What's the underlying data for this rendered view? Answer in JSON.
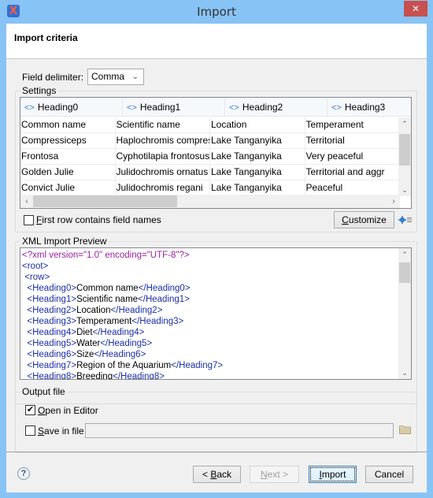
{
  "window": {
    "title": "Import",
    "app_icon": "oxygen-x-icon",
    "close_label": "✕"
  },
  "header": {
    "title": "Import criteria"
  },
  "delimiter": {
    "label": "Field delimiter:",
    "value": "Comma"
  },
  "settings": {
    "legend": "Settings",
    "columns": [
      "Heading0",
      "Heading1",
      "Heading2",
      "Heading3"
    ],
    "rows": [
      [
        "Common name",
        "Scientific name",
        "Location",
        "Temperament"
      ],
      [
        "Compressiceps",
        "Haplochromis compressi...",
        "Lake Tanganyika",
        "Territorial"
      ],
      [
        "Frontosa",
        "Cyphotilapia frontosus",
        "Lake Tanganyika",
        "Very peaceful"
      ],
      [
        "Golden Julie",
        "Julidochromis ornatus",
        "Lake Tanganyika",
        "Territorial and aggr"
      ],
      [
        "Convict Julie",
        "Julidochromis regani",
        "Lake Tanganyika",
        "Peaceful"
      ]
    ],
    "vertical_scroll_position": 0.3,
    "horizontal_scroll_position": 0.0,
    "first_row_label_prefix": "F",
    "first_row_label_rest": "irst row contains field names",
    "first_row_checked": false,
    "customize_prefix": "C",
    "customize_rest": "ustomize"
  },
  "xml_preview": {
    "legend": "XML Import Preview",
    "lines": [
      {
        "indent": "",
        "parts": [
          {
            "cls": "pi",
            "t": "<?xml version=\"1.0\" encoding=\"UTF-8\"?>"
          }
        ]
      },
      {
        "indent": "",
        "parts": [
          {
            "cls": "tg",
            "t": "<root>"
          }
        ]
      },
      {
        "indent": " ",
        "parts": [
          {
            "cls": "tg",
            "t": "<row>"
          }
        ]
      },
      {
        "indent": "  ",
        "parts": [
          {
            "cls": "tg",
            "t": "<Heading0>"
          },
          {
            "cls": "txt",
            "t": "Common name"
          },
          {
            "cls": "tg",
            "t": "</Heading0>"
          }
        ]
      },
      {
        "indent": "  ",
        "parts": [
          {
            "cls": "tg",
            "t": "<Heading1>"
          },
          {
            "cls": "txt",
            "t": "Scientific name"
          },
          {
            "cls": "tg",
            "t": "</Heading1>"
          }
        ]
      },
      {
        "indent": "  ",
        "parts": [
          {
            "cls": "tg",
            "t": "<Heading2>"
          },
          {
            "cls": "txt",
            "t": "Location"
          },
          {
            "cls": "tg",
            "t": "</Heading2>"
          }
        ]
      },
      {
        "indent": "  ",
        "parts": [
          {
            "cls": "tg",
            "t": "<Heading3>"
          },
          {
            "cls": "txt",
            "t": "Temperament"
          },
          {
            "cls": "tg",
            "t": "</Heading3>"
          }
        ]
      },
      {
        "indent": "  ",
        "parts": [
          {
            "cls": "tg",
            "t": "<Heading4>"
          },
          {
            "cls": "txt",
            "t": "Diet"
          },
          {
            "cls": "tg",
            "t": "</Heading4>"
          }
        ]
      },
      {
        "indent": "  ",
        "parts": [
          {
            "cls": "tg",
            "t": "<Heading5>"
          },
          {
            "cls": "txt",
            "t": "Water"
          },
          {
            "cls": "tg",
            "t": "</Heading5>"
          }
        ]
      },
      {
        "indent": "  ",
        "parts": [
          {
            "cls": "tg",
            "t": "<Heading6>"
          },
          {
            "cls": "txt",
            "t": "Size"
          },
          {
            "cls": "tg",
            "t": "</Heading6>"
          }
        ]
      },
      {
        "indent": "  ",
        "parts": [
          {
            "cls": "tg",
            "t": "<Heading7>"
          },
          {
            "cls": "txt",
            "t": "Region of the Aquarium"
          },
          {
            "cls": "tg",
            "t": "</Heading7>"
          }
        ]
      },
      {
        "indent": "  ",
        "parts": [
          {
            "cls": "tg",
            "t": "<Heading8>"
          },
          {
            "cls": "txt",
            "t": "Breeding"
          },
          {
            "cls": "tg",
            "t": "</Heading8>"
          }
        ]
      }
    ]
  },
  "output": {
    "legend": "Output file",
    "open_in_editor_prefix": "O",
    "open_in_editor_rest": "pen in Editor",
    "open_in_editor_checked": true,
    "save_in_file_prefix": "S",
    "save_in_file_rest": "ave in file",
    "save_in_file_checked": false,
    "file_path": ""
  },
  "footer": {
    "help_label": "?",
    "back_pre": "< ",
    "back_u": "B",
    "back_rest": "ack",
    "next_u": "N",
    "next_rest": "ext >",
    "import_u": "I",
    "import_rest": "mport",
    "cancel": "Cancel"
  },
  "colors": {
    "titlebar": "#88c3f5",
    "close": "#c75050",
    "xml_pi": "#9b1fa1",
    "xml_tag": "#1a2fa5"
  }
}
